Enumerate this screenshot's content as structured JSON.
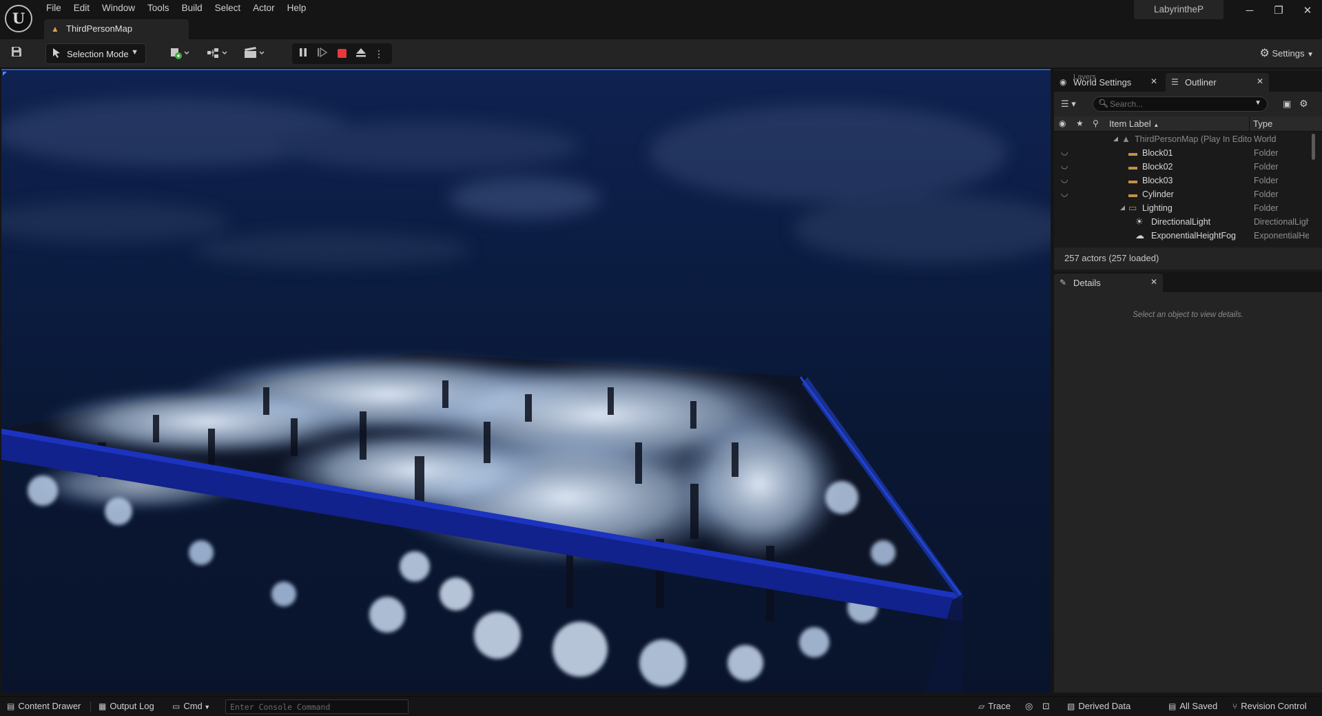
{
  "app": {
    "project_name": "LabyrintheP",
    "logo_text": "U",
    "menu": [
      "File",
      "Edit",
      "Window",
      "Tools",
      "Build",
      "Select",
      "Actor",
      "Help"
    ],
    "window_controls": {
      "minimize": "─",
      "restore": "❐",
      "close": "✕"
    }
  },
  "document_tab": {
    "label": "ThirdPersonMap",
    "warning_icon": "▲"
  },
  "toolbar": {
    "selection_mode": "Selection Mode",
    "settings": "Settings",
    "icons": {
      "save": "save-icon",
      "add_actor": "add-actor-icon",
      "blueprint": "blueprint-icon",
      "cinematics": "cinematics-icon",
      "pause": "pause-icon",
      "frame_skip": "frame-skip-icon",
      "stop": "stop-icon",
      "eject": "eject-icon",
      "more": "more-options-icon"
    }
  },
  "outliner": {
    "tabs": [
      {
        "label": "World Settings",
        "overlapped_label": "Layers"
      },
      {
        "label": "Outliner"
      }
    ],
    "search_placeholder": "Search...",
    "columns": {
      "label": "Item Label",
      "sort_arrow": "▲",
      "type": "Type"
    },
    "rows": [
      {
        "label": "ThirdPersonMap (Play In Editor)",
        "type": "World",
        "kind": "world",
        "depth": 0,
        "expanded": true,
        "dimmed": true
      },
      {
        "label": "Block01",
        "type": "Folder",
        "kind": "folder",
        "depth": 1
      },
      {
        "label": "Block02",
        "type": "Folder",
        "kind": "folder",
        "depth": 1
      },
      {
        "label": "Block03",
        "type": "Folder",
        "kind": "folder",
        "depth": 1
      },
      {
        "label": "Cylinder",
        "type": "Folder",
        "kind": "folder",
        "depth": 1
      },
      {
        "label": "Lighting",
        "type": "Folder",
        "kind": "folder-open",
        "depth": 1,
        "expanded": true
      },
      {
        "label": "DirectionalLight",
        "type": "DirectionalLight",
        "kind": "light",
        "depth": 2
      },
      {
        "label": "ExponentialHeightFog",
        "type": "ExponentialHeightFog",
        "kind": "fog",
        "depth": 2
      }
    ],
    "actor_count": "257 actors (257 loaded)"
  },
  "details": {
    "tab_label": "Details",
    "empty_text": "Select an object to view details."
  },
  "statusbar": {
    "content_drawer": "Content Drawer",
    "output_log": "Output Log",
    "cmd": "Cmd",
    "console_placeholder": "Enter Console Command",
    "trace": "Trace",
    "derived_data": "Derived Data",
    "all_saved": "All Saved",
    "revision_control": "Revision Control"
  },
  "colors": {
    "accent": "#1d5fd1",
    "stop": "#e8393a",
    "folder": "#c7914a",
    "maze_border": "#11228c",
    "sky": "#0e2146"
  }
}
